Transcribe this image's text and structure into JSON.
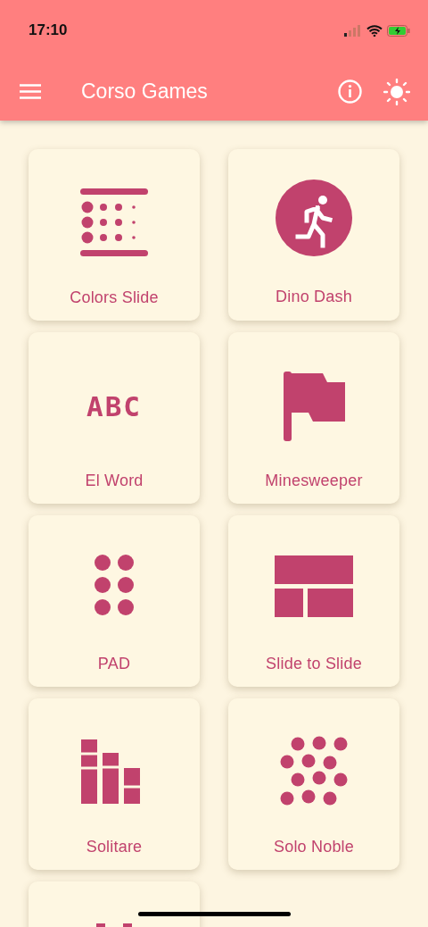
{
  "status_bar": {
    "time": "17:10"
  },
  "app_bar": {
    "title": "Corso Games"
  },
  "games": [
    {
      "kind": "dot-fade",
      "label": "Colors Slide"
    },
    {
      "kind": "runner",
      "label": "Dino Dash"
    },
    {
      "kind": "letters",
      "icon_text": "ABC",
      "label": "El Word"
    },
    {
      "kind": "flag",
      "label": "Minesweeper"
    },
    {
      "kind": "dots",
      "label": "PAD"
    },
    {
      "kind": "panels",
      "label": "Slide to Slide"
    },
    {
      "kind": "columns",
      "label": "Solitare"
    },
    {
      "kind": "scatter",
      "label": "Solo Noble"
    },
    {
      "kind": "bars"
    }
  ]
}
